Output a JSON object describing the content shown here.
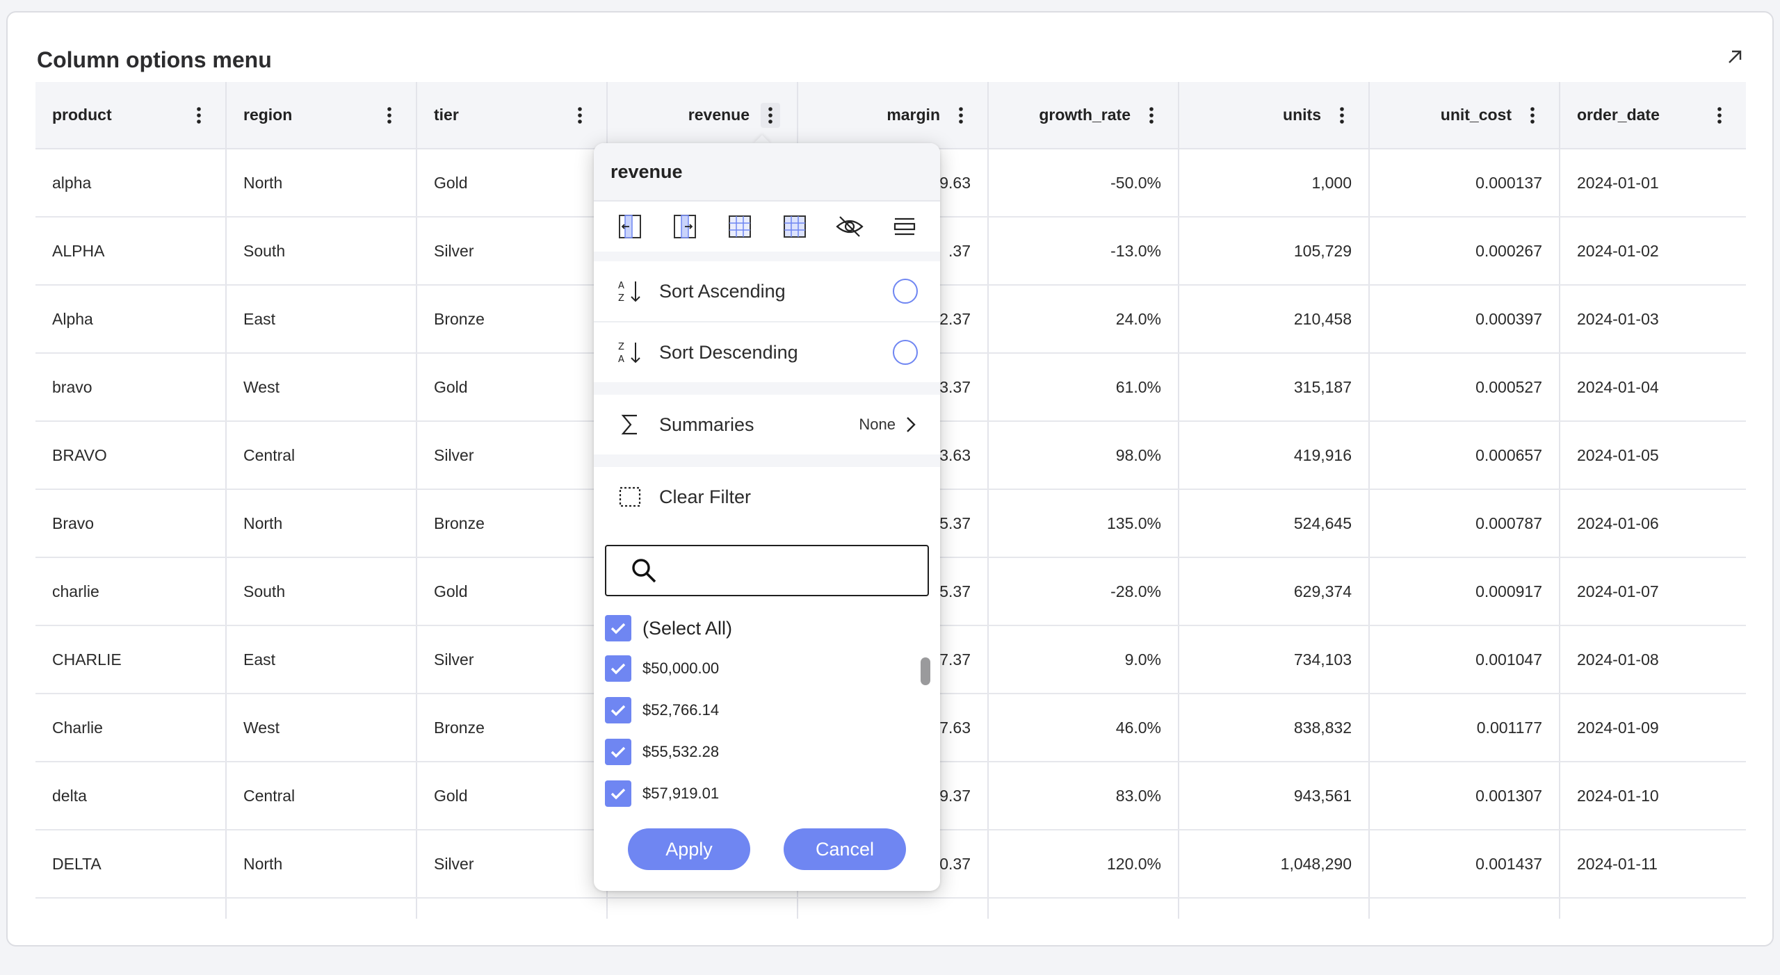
{
  "card": {
    "title": "Column options menu"
  },
  "grid": {
    "columns": [
      {
        "label": "product",
        "align": "left"
      },
      {
        "label": "region",
        "align": "left"
      },
      {
        "label": "tier",
        "align": "left"
      },
      {
        "label": "revenue",
        "align": "right"
      },
      {
        "label": "margin",
        "align": "right"
      },
      {
        "label": "growth_rate",
        "align": "right"
      },
      {
        "label": "units",
        "align": "right"
      },
      {
        "label": "unit_cost",
        "align": "right"
      },
      {
        "label": "order_date",
        "align": "left"
      }
    ],
    "rows": [
      [
        "alpha",
        "North",
        "Gold",
        "",
        "9.63",
        "-50.0%",
        "1,000",
        "0.000137",
        "2024-01-01"
      ],
      [
        "ALPHA",
        "South",
        "Silver",
        "",
        ".37",
        "-13.0%",
        "105,729",
        "0.000267",
        "2024-01-02"
      ],
      [
        "Alpha",
        "East",
        "Bronze",
        "",
        "2.37",
        "24.0%",
        "210,458",
        "0.000397",
        "2024-01-03"
      ],
      [
        "bravo",
        "West",
        "Gold",
        "",
        "3.37",
        "61.0%",
        "315,187",
        "0.000527",
        "2024-01-04"
      ],
      [
        "BRAVO",
        "Central",
        "Silver",
        "",
        "3.63",
        "98.0%",
        "419,916",
        "0.000657",
        "2024-01-05"
      ],
      [
        "Bravo",
        "North",
        "Bronze",
        "",
        "5.37",
        "135.0%",
        "524,645",
        "0.000787",
        "2024-01-06"
      ],
      [
        "charlie",
        "South",
        "Gold",
        "",
        "5.37",
        "-28.0%",
        "629,374",
        "0.000917",
        "2024-01-07"
      ],
      [
        "CHARLIE",
        "East",
        "Silver",
        "",
        "7.37",
        "9.0%",
        "734,103",
        "0.001047",
        "2024-01-08"
      ],
      [
        "Charlie",
        "West",
        "Bronze",
        "",
        "7.63",
        "46.0%",
        "838,832",
        "0.001177",
        "2024-01-09"
      ],
      [
        "delta",
        "Central",
        "Gold",
        "",
        "9.37",
        "83.0%",
        "943,561",
        "0.001307",
        "2024-01-10"
      ],
      [
        "DELTA",
        "North",
        "Silver",
        "",
        "0.37",
        "120.0%",
        "1,048,290",
        "0.001437",
        "2024-01-11"
      ]
    ]
  },
  "popup": {
    "title": "revenue",
    "sort_ascending": "Sort Ascending",
    "sort_descending": "Sort Descending",
    "summaries": "Summaries",
    "summaries_value": "None",
    "clear_filter": "Clear Filter",
    "search_value": "",
    "select_all": "(Select All)",
    "values": [
      "$50,000.00",
      "$52,766.14",
      "$55,532.28",
      "$57,919.01"
    ],
    "apply": "Apply",
    "cancel": "Cancel"
  },
  "colors": {
    "accent": "#6f86f2",
    "header_bg": "#f4f5f8"
  }
}
